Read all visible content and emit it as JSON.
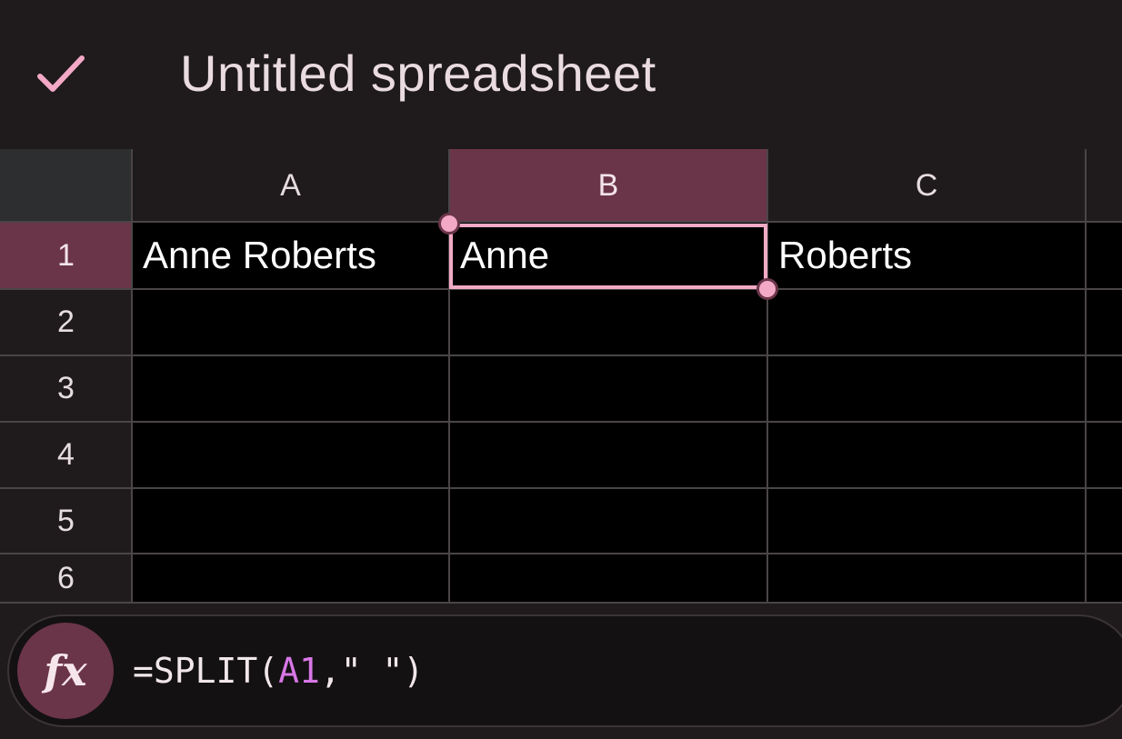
{
  "app": {
    "title": "Untitled spreadsheet",
    "done_icon": "checkmark-icon",
    "accent_color": "#6b3549",
    "selection_color": "#f1aac4"
  },
  "sheet": {
    "columns": [
      "A",
      "B",
      "C"
    ],
    "rows": [
      "1",
      "2",
      "3",
      "4",
      "5",
      "6"
    ],
    "selected_cell": "B1",
    "cells": {
      "A1": "Anne Roberts",
      "B1": "Anne",
      "C1": "Roberts"
    }
  },
  "formula_bar": {
    "icon": "fx-icon",
    "icon_label": "fx",
    "prefix": "=SPLIT(",
    "reference": "A1",
    "suffix": ",\" \")"
  }
}
